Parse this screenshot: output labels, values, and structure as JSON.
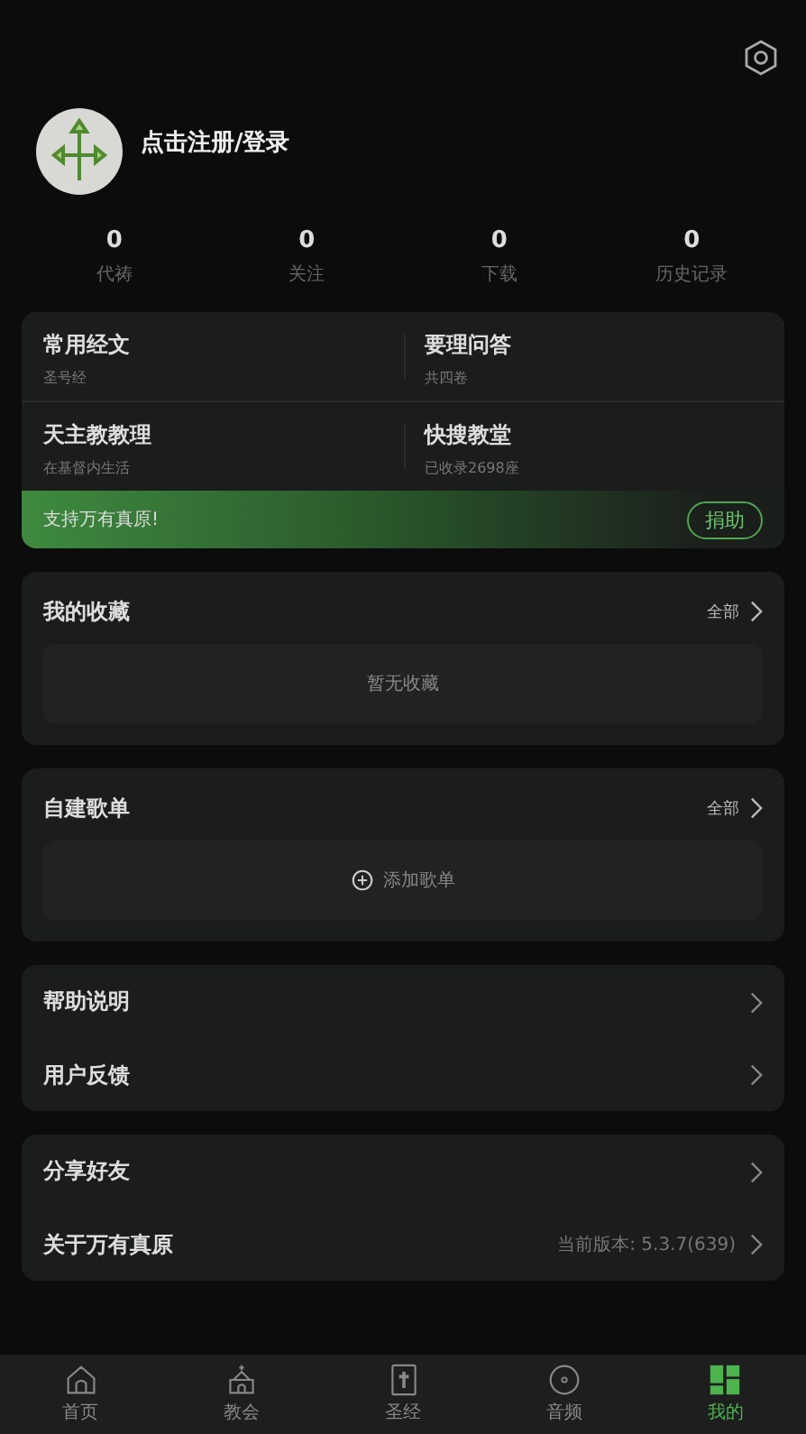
{
  "header": {
    "login_label": "点击注册/登录"
  },
  "stats": [
    {
      "value": "0",
      "label": "代祷"
    },
    {
      "value": "0",
      "label": "关注"
    },
    {
      "value": "0",
      "label": "下载"
    },
    {
      "value": "0",
      "label": "历史记录"
    }
  ],
  "shortcuts": [
    {
      "title": "常用经文",
      "subtitle": "圣号经"
    },
    {
      "title": "要理问答",
      "subtitle": "共四卷"
    },
    {
      "title": "天主教教理",
      "subtitle": "在基督内生活"
    },
    {
      "title": "快搜教堂",
      "subtitle": "已收录2698座"
    }
  ],
  "donate_banner": {
    "text": "支持万有真原!",
    "button": "捐助"
  },
  "sections": [
    {
      "kind": "empty",
      "title": "我的收藏",
      "more": "全部",
      "body": "暂无收藏"
    },
    {
      "kind": "add",
      "title": "自建歌单",
      "more": "全部",
      "body": "添加歌单"
    }
  ],
  "menu_groups": [
    [
      {
        "label": "帮助说明"
      },
      {
        "label": "用户反馈"
      }
    ],
    [
      {
        "label": "分享好友"
      },
      {
        "label": "关于万有真原",
        "detail": "当前版本: 5.3.7(639)"
      }
    ]
  ],
  "tab_bar": [
    {
      "label": "首页",
      "selected": false
    },
    {
      "label": "教会",
      "selected": false
    },
    {
      "label": "圣经",
      "selected": false
    },
    {
      "label": "音频",
      "selected": false
    },
    {
      "label": "我的",
      "selected": true
    }
  ]
}
